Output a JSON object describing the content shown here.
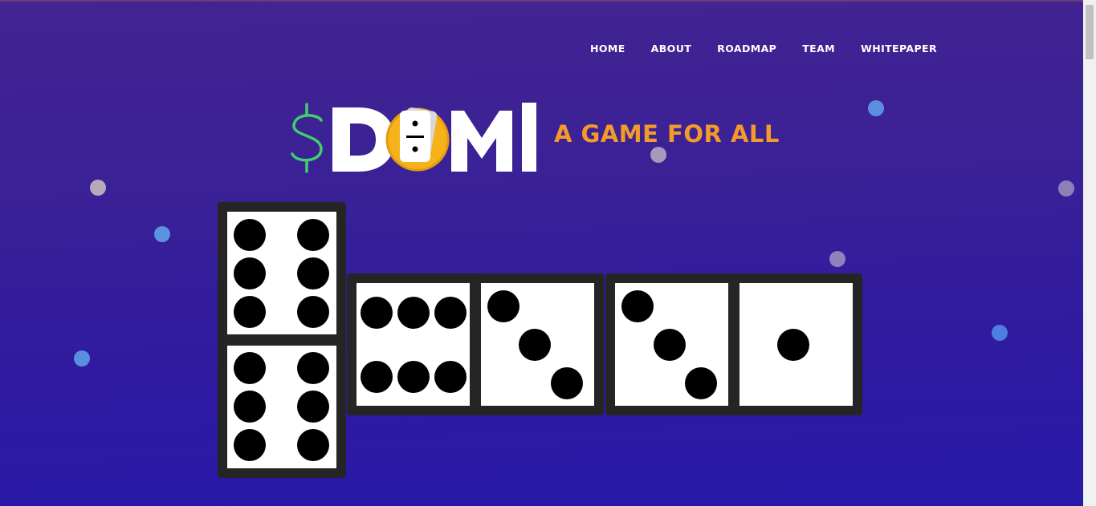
{
  "nav": {
    "items": [
      "HOME",
      "ABOUT",
      "ROADMAP",
      "TEAM",
      "WHITEPAPER"
    ]
  },
  "logo": {
    "dollar": "$",
    "text_d": "D",
    "text_mi": "MI",
    "alt": "$DOMI"
  },
  "tagline": "A GAME FOR ALL",
  "colors": {
    "accent": "#f39a2b",
    "dollar_green": "#3ed16a",
    "logo_white": "#ffffff",
    "coin_yellow": "#f4b21b",
    "domino_frame": "#252525"
  },
  "dominoes": [
    {
      "orientation": "vertical",
      "pips": [
        6,
        6
      ]
    },
    {
      "orientation": "horizontal",
      "pips": [
        6,
        3
      ]
    },
    {
      "orientation": "horizontal",
      "pips": [
        3,
        1
      ]
    }
  ]
}
